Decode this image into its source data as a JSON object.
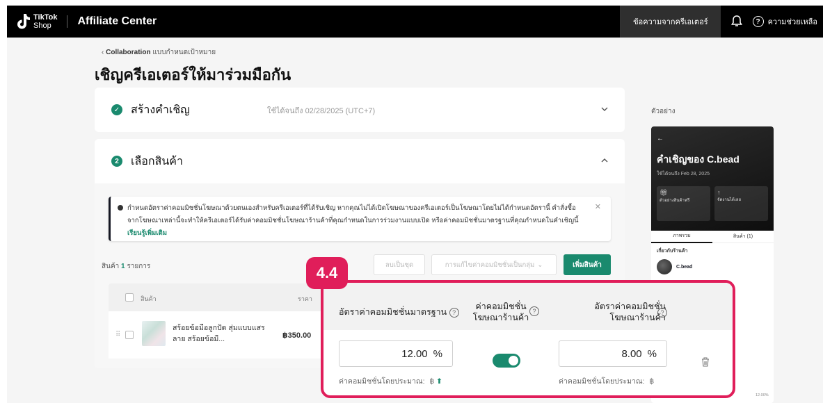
{
  "header": {
    "logo_line1": "TikTok",
    "logo_line2": "Shop",
    "app_title": "Affiliate Center",
    "creator_messages": "ข้อความจากครีเอเตอร์",
    "help_label": "ความช่วยเหลือ"
  },
  "breadcrumb": {
    "parent": "Collaboration",
    "current": "แบบกำหนดเป้าหมาย"
  },
  "page_title": "เชิญครีเอเตอร์ให้มาร่วมมือกัน",
  "step1": {
    "title": "สร้างคำเชิญ",
    "valid_until": "ใช้ได้จนถึง 02/28/2025 (UTC+7)"
  },
  "step2": {
    "number": "2",
    "title": "เลือกสินค้า",
    "notice_text": "กำหนดอัตราค่าคอมมิชชั่นโฆษณาด้วยตนเองสำหรับครีเอเตอร์ที่ได้รับเชิญ หากคุณไม่ได้เปิดโฆษณาของครีเอเตอร์เป็นโฆษณาโดยไม่ได้กำหนดอัตรานี้ คำสั่งซื้อจากโฆษณาเหล่านี้จะทำให้ครีเอเตอร์ได้รับค่าคอมมิชชั่นโฆษณาร้านค้าที่คุณกำหนดในการร่วมงานแบบเปิด หรือค่าคอมมิชชั่นมาตรฐานที่คุณกำหนดในคำเชิญนี้",
    "notice_link": "เรียนรู้เพิ่มเติม",
    "products_prefix": "สินค้า",
    "products_count": "1",
    "products_suffix": "รายการ",
    "btn_remove_bulk": "ลบเป็นชุด",
    "btn_set_commission": "การแก้ไขค่าคอมมิชชั่นเป็นกลุ่ม",
    "btn_add_product": "เพิ่มสินค้า",
    "table_headers": {
      "product": "สินค้า",
      "price": "ราคา"
    },
    "product": {
      "name": "สร้อยข้อมือลูกปัด สุ่มแบบแสรลาย สร้อยข้อมื...",
      "price": "฿350.00"
    }
  },
  "commission_panel": {
    "step_badge": "4.4",
    "col_standard": "อัตราค่าคอมมิชชั่นมาตรฐาน",
    "col_ads_toggle": "ค่าคอมมิชชั่นโฆษณาร้านค้า",
    "col_ads_rate": "อัตราค่าคอมมิชชั่นโฆษณาร้านค้า",
    "standard_value": "12.00",
    "ads_value": "8.00",
    "percent": "%",
    "estimate_label": "ค่าคอมมิชชั่นโดยประมาณ:",
    "currency": "฿",
    "toggle_on": true
  },
  "preview": {
    "label": "ตัวอย่าง",
    "title": "คำเชิญของ C.bead",
    "subtitle": "ใช้ได้จนถึง Feb 28, 2025",
    "tile1": "ตัวอย่างสินค้าฟรี",
    "tile2": "จัดงานได้เลย",
    "tab1": "ภาพรวม",
    "tab2": "สินค้า (1)",
    "section": "เกี่ยวกับร้านค้า",
    "creator": "C.bead",
    "side_rate": "12.00%"
  },
  "colors": {
    "accent": "#1a8a6e",
    "highlight": "#e01e5a",
    "topbar": "#000000"
  }
}
